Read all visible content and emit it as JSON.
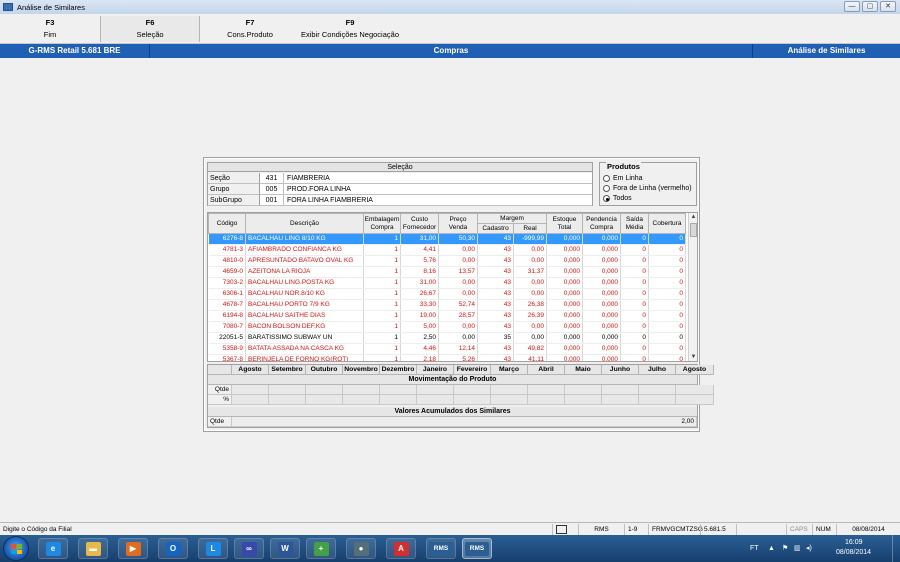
{
  "window": {
    "title": "Análise de Similares",
    "controls": [
      "—",
      "▢",
      "✕"
    ]
  },
  "fkeys": [
    {
      "key": "F3",
      "label": "Fim"
    },
    {
      "key": "F6",
      "label": "Seleção"
    },
    {
      "key": "F7",
      "label": "Cons.Produto"
    },
    {
      "key": "F9",
      "label": "Exibir Condições Negociação"
    }
  ],
  "header": {
    "left": "G-RMS Retail 5.681 BRE",
    "center": "Compras",
    "right": "Análise de Similares"
  },
  "selecao": {
    "title": "Seleção",
    "rows": [
      {
        "label": "Seção",
        "code": "431",
        "desc": "FIAMBRERIA"
      },
      {
        "label": "Grupo",
        "code": "005",
        "desc": "PROD.FORA LINHA"
      },
      {
        "label": "SubGrupo",
        "code": "001",
        "desc": "FORA LINHA FIAMBRERIA"
      }
    ]
  },
  "produtos": {
    "title": "Produtos",
    "options": [
      {
        "label": "Em Linha",
        "selected": false
      },
      {
        "label": "Fora de Linha (vermelho)",
        "selected": false
      },
      {
        "label": "Todos",
        "selected": true
      }
    ]
  },
  "table": {
    "headers": {
      "codigo": "Código",
      "descricao": "Descrição",
      "embalagem": [
        "Embalagem",
        "Compra"
      ],
      "custo": [
        "Custo",
        "Fornecedor"
      ],
      "preco": [
        "Preço",
        "Venda"
      ],
      "margem": "Margem",
      "cadastro": "Cadastro",
      "real": "Real",
      "estoque": [
        "Estoque",
        "Total"
      ],
      "pendencia": [
        "Pendencia",
        "Compra"
      ],
      "saida": [
        "Saída",
        "Média"
      ],
      "cobertura": "Cobertura"
    },
    "rows": [
      {
        "codigo": "6276-8",
        "descricao": "BACALHAU LING 8/10 KG",
        "emb": "1",
        "custo": "31,00",
        "preco": "50,30",
        "cad": "43",
        "real": "-999,99",
        "estoque": "0,000",
        "pend": "0,000",
        "saida": "0",
        "cob": "0",
        "style": "sel"
      },
      {
        "codigo": "4781-3",
        "descricao": "AFIAMBRADO CONFIANCA KG",
        "emb": "1",
        "custo": "4,41",
        "preco": "0,00",
        "cad": "43",
        "real": "0,00",
        "estoque": "0,000",
        "pend": "0,000",
        "saida": "0",
        "cob": "0",
        "style": "red"
      },
      {
        "codigo": "4810-0",
        "descricao": "APRESUNTADO BATAVO OVAL KG",
        "emb": "1",
        "custo": "5,76",
        "preco": "0,00",
        "cad": "43",
        "real": "0,00",
        "estoque": "0,000",
        "pend": "0,000",
        "saida": "0",
        "cob": "0",
        "style": "red"
      },
      {
        "codigo": "4659-0",
        "descricao": "AZEITONA LA RIOJA",
        "emb": "1",
        "custo": "8,16",
        "preco": "13,57",
        "cad": "43",
        "real": "31,37",
        "estoque": "0,000",
        "pend": "0,000",
        "saida": "0",
        "cob": "0",
        "style": "red"
      },
      {
        "codigo": "7303-2",
        "descricao": "BACALHAU LING.POSTA KG",
        "emb": "1",
        "custo": "31,00",
        "preco": "0,00",
        "cad": "43",
        "real": "0,00",
        "estoque": "0,000",
        "pend": "0,000",
        "saida": "0",
        "cob": "0",
        "style": "red"
      },
      {
        "codigo": "6306-1",
        "descricao": "BACALHAU NOR.8/10 KG",
        "emb": "1",
        "custo": "26,67",
        "preco": "0,00",
        "cad": "43",
        "real": "0,00",
        "estoque": "0,000",
        "pend": "0,000",
        "saida": "0",
        "cob": "0",
        "style": "red"
      },
      {
        "codigo": "4678-7",
        "descricao": "BACALHAU PORTO 7/9 KG",
        "emb": "1",
        "custo": "33,30",
        "preco": "52,74",
        "cad": "43",
        "real": "26,38",
        "estoque": "0,000",
        "pend": "0,000",
        "saida": "0",
        "cob": "0",
        "style": "red"
      },
      {
        "codigo": "6194-8",
        "descricao": "BACALHAU SAITHE DIAS",
        "emb": "1",
        "custo": "19,00",
        "preco": "28,57",
        "cad": "43",
        "real": "26,39",
        "estoque": "0,000",
        "pend": "0,000",
        "saida": "0",
        "cob": "0",
        "style": "red"
      },
      {
        "codigo": "7080-7",
        "descricao": "BACON BOLSON DEF.KG",
        "emb": "1",
        "custo": "5,00",
        "preco": "0,00",
        "cad": "43",
        "real": "0,00",
        "estoque": "0,000",
        "pend": "0,000",
        "saida": "0",
        "cob": "0",
        "style": "red"
      },
      {
        "codigo": "22051-5",
        "descricao": "BARATISSIMO SUBWAY UN",
        "emb": "1",
        "custo": "2,50",
        "preco": "0,00",
        "cad": "35",
        "real": "0,00",
        "estoque": "0,000",
        "pend": "0,000",
        "saida": "0",
        "cob": "0",
        "style": "black"
      },
      {
        "codigo": "5358-9",
        "descricao": "BATATA ASSADA NA CASCA KG",
        "emb": "1",
        "custo": "4,46",
        "preco": "12,14",
        "cad": "43",
        "real": "49,82",
        "estoque": "0,000",
        "pend": "0,000",
        "saida": "0",
        "cob": "0",
        "style": "red"
      },
      {
        "codigo": "5367-8",
        "descricao": "BERINJELA DE FORNO KG(ROT)",
        "emb": "1",
        "custo": "2,18",
        "preco": "5,26",
        "cad": "43",
        "real": "41,11",
        "estoque": "0,000",
        "pend": "0,000",
        "saida": "0",
        "cob": "0",
        "style": "red"
      }
    ]
  },
  "months": {
    "columns": [
      "Agosto",
      "Setembro",
      "Outubro",
      "Novembro",
      "Dezembro",
      "Janeiro",
      "Fevereiro",
      "Março",
      "Abril",
      "Maio",
      "Junho",
      "Julho",
      "Agosto"
    ],
    "movimentacao_title": "Movimentação do Produto",
    "row_qtde": "Qtde",
    "row_pct": "%",
    "acumulados_title": "Valores Acumulados dos Similares",
    "acum_label": "Qtde",
    "acum_value": "2,00"
  },
  "status": {
    "message": "Digite o Código da Filial",
    "app": "RMS",
    "page": "1-9",
    "user": "FRMVGCMTZSG",
    "version": "5.681.5",
    "caps": "CAPS",
    "num": "NUM",
    "date": "08/08/2014"
  },
  "taskbar": {
    "apps": [
      {
        "name": "ie",
        "glyph": "e",
        "color": "#1e88e5"
      },
      {
        "name": "explorer",
        "glyph": "▬",
        "color": "#e8b84a"
      },
      {
        "name": "media",
        "glyph": "▶",
        "color": "#e26b1c"
      },
      {
        "name": "outlook",
        "glyph": "O",
        "color": "#1565c0"
      },
      {
        "name": "lync",
        "glyph": "L",
        "color": "#1e88e5"
      },
      {
        "name": "app6",
        "glyph": "∞",
        "color": "#3949ab"
      },
      {
        "name": "word",
        "glyph": "W",
        "color": "#2b579a"
      },
      {
        "name": "app8",
        "glyph": "+",
        "color": "#43a047"
      },
      {
        "name": "app9",
        "glyph": "●",
        "color": "#546e7a"
      },
      {
        "name": "acrobat",
        "glyph": "A",
        "color": "#d32f2f"
      },
      {
        "name": "rms1",
        "glyph": "RMS",
        "color": "#2b5f94"
      },
      {
        "name": "rms2",
        "glyph": "RMS",
        "color": "#2b5f94"
      }
    ],
    "tray_lang": "FT",
    "time": "16:09",
    "date": "08/08/2014"
  }
}
